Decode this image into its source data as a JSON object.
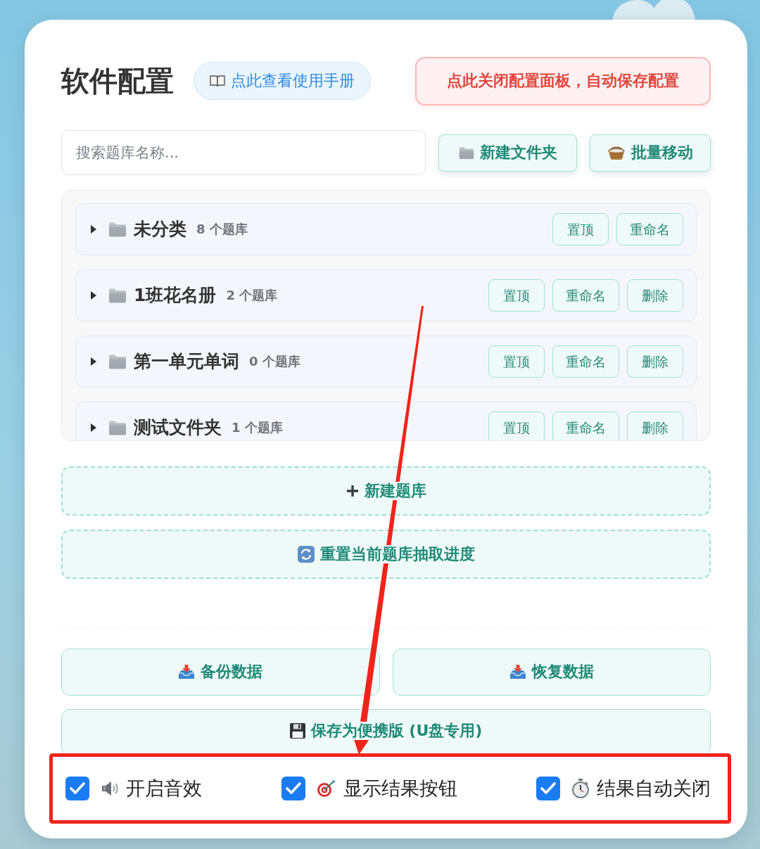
{
  "header": {
    "title": "软件配置",
    "manual_button": "点此查看使用手册",
    "close_button": "点此关闭配置面板，自动保存配置"
  },
  "search": {
    "placeholder": "搜索题库名称..."
  },
  "toolbar": [
    {
      "kind": "new_folder",
      "label": "新建文件夹"
    },
    {
      "kind": "batch_move",
      "label": "批量移动"
    }
  ],
  "folders": [
    {
      "name": "未分类",
      "count": "8 个题库",
      "expanded": false,
      "actions": [
        "置顶",
        "重命名"
      ]
    },
    {
      "name": "1班花名册",
      "count": "2 个题库",
      "expanded": false,
      "actions": [
        "置顶",
        "重命名",
        "删除"
      ]
    },
    {
      "name": "第一单元单词",
      "count": "0 个题库",
      "expanded": false,
      "actions": [
        "置顶",
        "重命名",
        "删除"
      ]
    },
    {
      "name": "测试文件夹",
      "count": "1 个题库",
      "expanded": false,
      "actions": [
        "置顶",
        "重命名",
        "删除"
      ]
    }
  ],
  "bank_actions": [
    {
      "kind": "add",
      "label": "新建题库"
    },
    {
      "kind": "reset",
      "label": "重置当前题库抽取进度"
    }
  ],
  "data_buttons": [
    "备份数据",
    "恢复数据"
  ],
  "portable_button": "保存为便携版 (U盘专用)",
  "options": [
    {
      "kind": "sound",
      "label": "开启音效",
      "checked": true
    },
    {
      "kind": "result_button",
      "label": "显示结果按钮",
      "checked": true
    },
    {
      "kind": "auto_close",
      "label": "结果自动关闭",
      "checked": true
    }
  ]
}
